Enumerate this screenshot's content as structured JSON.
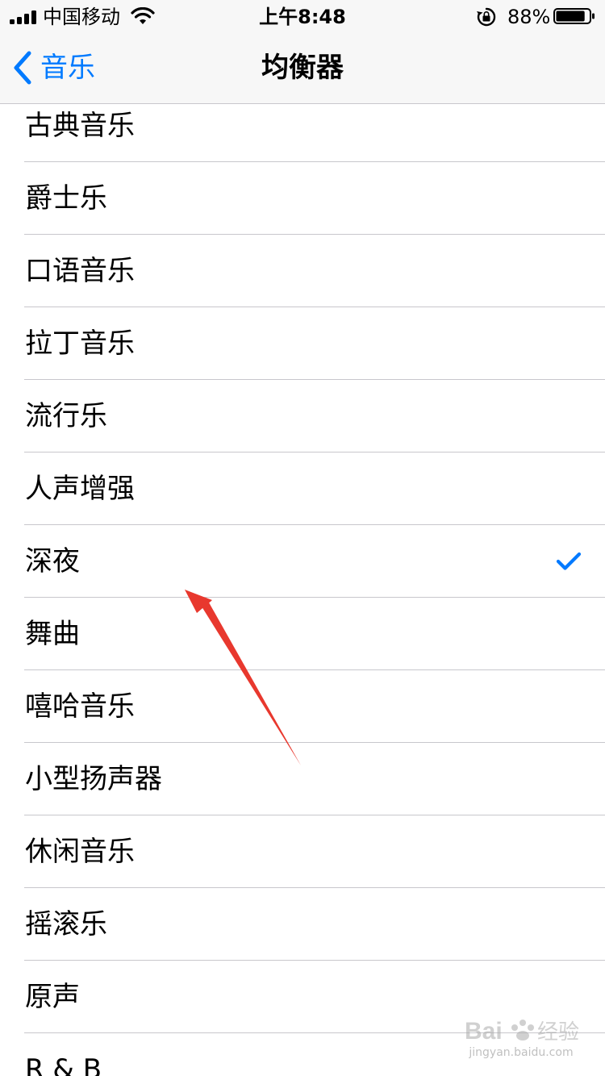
{
  "status_bar": {
    "carrier": "中国移动",
    "time": "上午8:48",
    "battery_percent": "88%",
    "battery_level": 0.88,
    "signal_bars": 4,
    "icons": [
      "signal-icon",
      "wifi-icon",
      "rotation-lock-icon",
      "battery-icon"
    ]
  },
  "nav": {
    "back_label": "音乐",
    "title": "均衡器",
    "back_icon": "chevron-left-icon"
  },
  "equalizer_list": {
    "items": [
      {
        "label": "古典音乐",
        "selected": false
      },
      {
        "label": "爵士乐",
        "selected": false
      },
      {
        "label": "口语音乐",
        "selected": false
      },
      {
        "label": "拉丁音乐",
        "selected": false
      },
      {
        "label": "流行乐",
        "selected": false
      },
      {
        "label": "人声增强",
        "selected": false
      },
      {
        "label": "深夜",
        "selected": true
      },
      {
        "label": "舞曲",
        "selected": false
      },
      {
        "label": "嘻哈音乐",
        "selected": false
      },
      {
        "label": "小型扬声器",
        "selected": false
      },
      {
        "label": "休闲音乐",
        "selected": false
      },
      {
        "label": "摇滚乐",
        "selected": false
      },
      {
        "label": "原声",
        "selected": false
      },
      {
        "label": "R & B",
        "selected": false
      }
    ],
    "selected_icon": "checkmark-icon"
  },
  "colors": {
    "accent": "#007aff",
    "bar_background": "#f7f7f7",
    "separator": "#c8c7cc",
    "annotation_arrow": "#e8382e"
  },
  "watermark": {
    "logo_text": "Baidu经验",
    "url_text": "jingyan.baidu.com"
  }
}
